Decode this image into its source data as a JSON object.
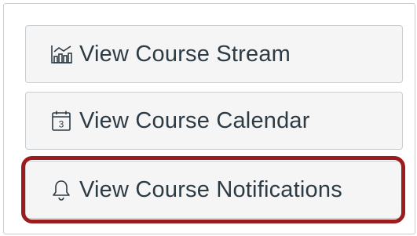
{
  "buttons": [
    {
      "label": "View Course Stream",
      "icon": "stream-chart-icon"
    },
    {
      "label": "View Course Calendar",
      "icon": "calendar-icon",
      "icon_text": "3"
    },
    {
      "label": "View Course Notifications",
      "icon": "bell-icon"
    }
  ],
  "colors": {
    "button_bg": "#f5f5f5",
    "button_border": "#c7cdd1",
    "text": "#2d3b45",
    "highlight": "#9b1c1c"
  }
}
